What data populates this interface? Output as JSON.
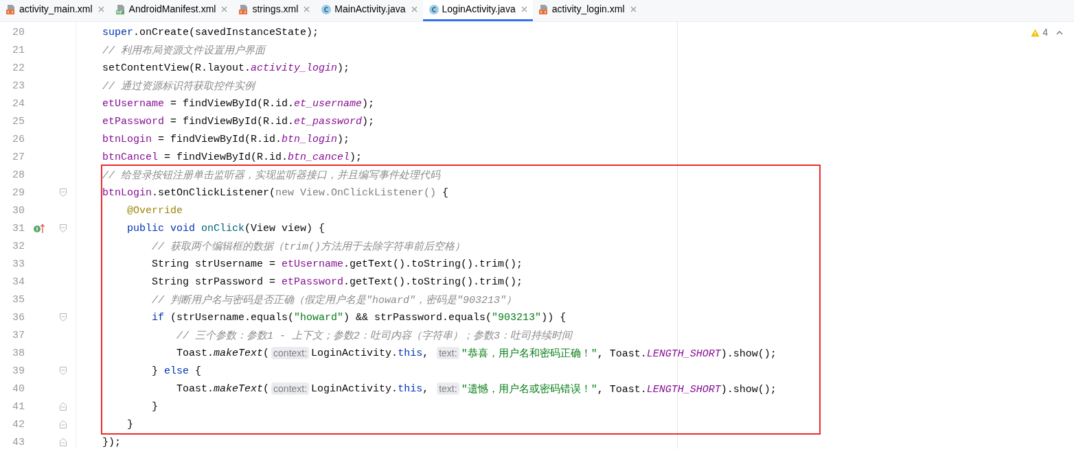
{
  "tabs": [
    {
      "label": "activity_main.xml",
      "kind": "xml",
      "selected": false
    },
    {
      "label": "AndroidManifest.xml",
      "kind": "manifest",
      "selected": false
    },
    {
      "label": "strings.xml",
      "kind": "xml",
      "selected": false
    },
    {
      "label": "MainActivity.java",
      "kind": "class",
      "selected": false
    },
    {
      "label": "LoginActivity.java",
      "kind": "class",
      "selected": true
    },
    {
      "label": "activity_login.xml",
      "kind": "xml",
      "selected": false
    }
  ],
  "inspection": {
    "warnings": "4"
  },
  "editor": {
    "blocks": [
      {
        "highlighted": false,
        "lines": [
          {
            "number": "20",
            "tokens": [
              {
                "text": "super",
                "kind": "keyword"
              },
              {
                "text": ".onCreate(savedInstanceState);",
                "kind": "plain"
              }
            ]
          },
          {
            "number": "21",
            "tokens": [
              {
                "text": "// 利用布局资源文件设置用户界面",
                "kind": "comment"
              }
            ]
          },
          {
            "number": "22",
            "tokens": [
              {
                "text": "setContentView(R.layout.",
                "kind": "plain"
              },
              {
                "text": "activity_login",
                "kind": "static_field"
              },
              {
                "text": ");",
                "kind": "plain"
              }
            ]
          },
          {
            "number": "23",
            "tokens": [
              {
                "text": "// 通过资源标识符获取控件实例",
                "kind": "comment"
              }
            ]
          },
          {
            "number": "24",
            "tokens": [
              {
                "text": "etUsername",
                "kind": "field"
              },
              {
                "text": " = findViewById(R.id.",
                "kind": "plain"
              },
              {
                "text": "et_username",
                "kind": "static_field"
              },
              {
                "text": ");",
                "kind": "plain"
              }
            ]
          },
          {
            "number": "25",
            "tokens": [
              {
                "text": "etPassword",
                "kind": "field"
              },
              {
                "text": " = findViewById(R.id.",
                "kind": "plain"
              },
              {
                "text": "et_password",
                "kind": "static_field"
              },
              {
                "text": ");",
                "kind": "plain"
              }
            ]
          },
          {
            "number": "26",
            "tokens": [
              {
                "text": "btnLogin",
                "kind": "field"
              },
              {
                "text": " = findViewById(R.id.",
                "kind": "plain"
              },
              {
                "text": "btn_login",
                "kind": "static_field"
              },
              {
                "text": ");",
                "kind": "plain"
              }
            ]
          },
          {
            "number": "27",
            "tokens": [
              {
                "text": "btnCancel",
                "kind": "field"
              },
              {
                "text": " = findViewById(R.id.",
                "kind": "plain"
              },
              {
                "text": "btn_cancel",
                "kind": "static_field"
              },
              {
                "text": ");",
                "kind": "plain"
              }
            ]
          }
        ]
      },
      {
        "highlighted": true,
        "lines": [
          {
            "number": "28",
            "tokens": [
              {
                "text": "// 给登录按钮注册单击监听器，实现监听器接口，并且编写事件处理代码",
                "kind": "comment"
              }
            ]
          },
          {
            "number": "29",
            "fold_start": true,
            "tokens": [
              {
                "text": "btnLogin",
                "kind": "field"
              },
              {
                "text": ".setOnClickListener(",
                "kind": "plain"
              },
              {
                "text": "new View.OnClickListener()",
                "kind": "dimmed"
              },
              {
                "text": " {",
                "kind": "plain"
              }
            ]
          },
          {
            "number": "30",
            "tokens": [
              {
                "text": "    @Override",
                "kind": "annotation"
              }
            ]
          },
          {
            "number": "31",
            "fold_start": true,
            "override_marker": true,
            "tokens": [
              {
                "text": "    public void ",
                "kind": "keyword"
              },
              {
                "text": "onClick",
                "kind": "method"
              },
              {
                "text": "(View view) {",
                "kind": "plain"
              }
            ]
          },
          {
            "number": "32",
            "tokens": [
              {
                "text": "        // 获取两个编辑框的数据（trim()方法用于去除字符串前后空格）",
                "kind": "comment"
              }
            ]
          },
          {
            "number": "33",
            "tokens": [
              {
                "text": "        String strUsername = ",
                "kind": "plain"
              },
              {
                "text": "etUsername",
                "kind": "field"
              },
              {
                "text": ".getText().toString().trim();",
                "kind": "plain"
              }
            ]
          },
          {
            "number": "34",
            "tokens": [
              {
                "text": "        String strPassword = ",
                "kind": "plain"
              },
              {
                "text": "etPassword",
                "kind": "field"
              },
              {
                "text": ".getText().toString().trim();",
                "kind": "plain"
              }
            ]
          },
          {
            "number": "35",
            "tokens": [
              {
                "text": "        // 判断用户名与密码是否正确（假定用户名是\"howard\"，密码是\"903213\"）",
                "kind": "comment"
              }
            ]
          },
          {
            "number": "36",
            "fold_start": true,
            "tokens": [
              {
                "text": "        if",
                "kind": "keyword"
              },
              {
                "text": " (strUsername.equals(",
                "kind": "plain"
              },
              {
                "text": "\"howard\"",
                "kind": "string"
              },
              {
                "text": ") && strPassword.equals(",
                "kind": "plain"
              },
              {
                "text": "\"903213\"",
                "kind": "string"
              },
              {
                "text": ")) {",
                "kind": "plain"
              }
            ]
          },
          {
            "number": "37",
            "tokens": [
              {
                "text": "            // 三个参数：参数1 - 上下文；参数2：吐司内容（字符串）；参数3：吐司持续时间",
                "kind": "comment"
              }
            ]
          },
          {
            "number": "38",
            "tokens": [
              {
                "text": "            Toast.",
                "kind": "plain"
              },
              {
                "text": "makeText",
                "kind": "static_method"
              },
              {
                "text": "(",
                "kind": "plain"
              },
              {
                "text": "context:",
                "kind": "hint"
              },
              {
                "text": "LoginActivity.",
                "kind": "plain"
              },
              {
                "text": "this",
                "kind": "keyword"
              },
              {
                "text": ", ",
                "kind": "plain"
              },
              {
                "text": "text:",
                "kind": "hint"
              },
              {
                "text": "\"恭喜，用户名和密码正确！\"",
                "kind": "string"
              },
              {
                "text": ", Toast.",
                "kind": "plain"
              },
              {
                "text": "LENGTH_SHORT",
                "kind": "static_field"
              },
              {
                "text": ").show();",
                "kind": "plain"
              }
            ]
          },
          {
            "number": "39",
            "fold_start": true,
            "tokens": [
              {
                "text": "        } ",
                "kind": "plain"
              },
              {
                "text": "else",
                "kind": "keyword"
              },
              {
                "text": " {",
                "kind": "plain"
              }
            ]
          },
          {
            "number": "40",
            "tokens": [
              {
                "text": "            Toast.",
                "kind": "plain"
              },
              {
                "text": "makeText",
                "kind": "static_method"
              },
              {
                "text": "(",
                "kind": "plain"
              },
              {
                "text": "context:",
                "kind": "hint"
              },
              {
                "text": "LoginActivity.",
                "kind": "plain"
              },
              {
                "text": "this",
                "kind": "keyword"
              },
              {
                "text": ", ",
                "kind": "plain"
              },
              {
                "text": "text:",
                "kind": "hint"
              },
              {
                "text": "\"遗憾，用户名或密码错误！\"",
                "kind": "string"
              },
              {
                "text": ", Toast.",
                "kind": "plain"
              },
              {
                "text": "LENGTH_SHORT",
                "kind": "static_field"
              },
              {
                "text": ").show();",
                "kind": "plain"
              }
            ]
          },
          {
            "number": "41",
            "fold_end": true,
            "tokens": [
              {
                "text": "        }",
                "kind": "plain"
              }
            ]
          },
          {
            "number": "42",
            "fold_end": true,
            "tokens": [
              {
                "text": "    }",
                "kind": "plain"
              }
            ]
          }
        ]
      },
      {
        "highlighted": false,
        "lines": [
          {
            "number": "43",
            "fold_end": true,
            "tokens": [
              {
                "text": "});",
                "kind": "plain"
              }
            ]
          }
        ]
      }
    ]
  }
}
